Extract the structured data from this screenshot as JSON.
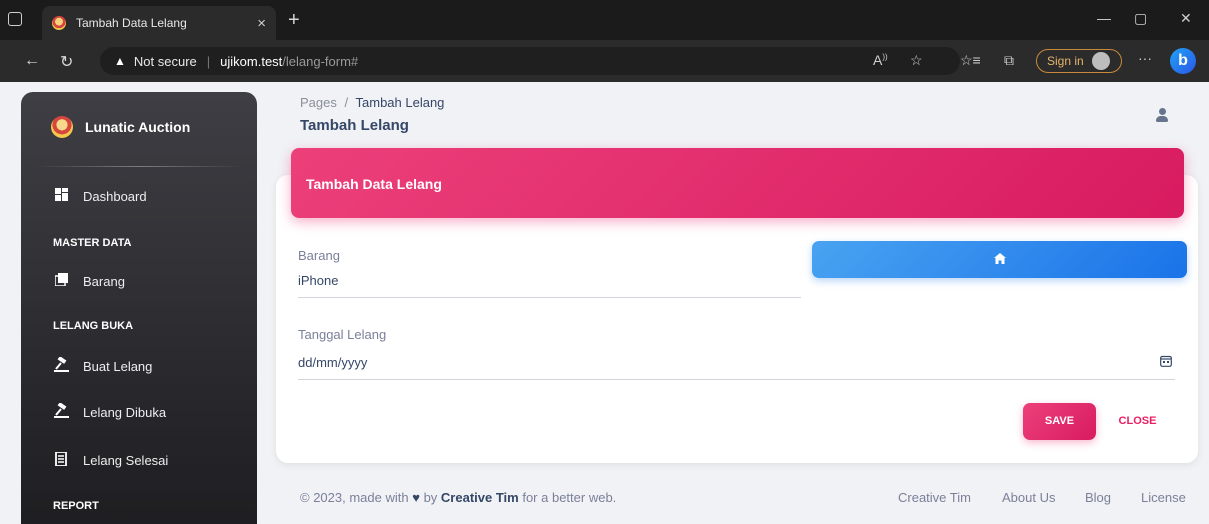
{
  "browser": {
    "tab_title": "Tambah Data Lelang",
    "tab_close": "×",
    "new_tab": "+",
    "minimize": "—",
    "maximize": "▢",
    "close": "✕",
    "security_label": "Not secure",
    "url_host": "ujikom.test",
    "url_path": "/lelang-form#",
    "sign_in": "Sign in",
    "more": "···",
    "bing": "b"
  },
  "sidebar": {
    "brand": "Lunatic Auction",
    "dashboard": "Dashboard",
    "section_master": "MASTER DATA",
    "barang": "Barang",
    "section_lelang": "LELANG BUKA",
    "buat_lelang": "Buat Lelang",
    "lelang_dibuka": "Lelang Dibuka",
    "lelang_selesai": "Lelang Selesai",
    "section_report": "REPORT"
  },
  "header": {
    "breadcrumb_root": "Pages",
    "breadcrumb_sep": "/",
    "breadcrumb_current": "Tambah Lelang",
    "page_title": "Tambah Lelang"
  },
  "form": {
    "card_title": "Tambah Data Lelang",
    "barang_label": "Barang",
    "barang_value": "iPhone",
    "tanggal_label": "Tanggal Lelang",
    "tanggal_value": "dd/mm/yyyy",
    "save": "SAVE",
    "close": "CLOSE"
  },
  "footer": {
    "copyright": "© 2023, made with",
    "by": "by",
    "author": "Creative Tim",
    "suffix": "for a better web.",
    "links": [
      "Creative Tim",
      "About Us",
      "Blog",
      "License"
    ]
  },
  "colors": {
    "primary": "#e91e63",
    "info": "#1a73e8",
    "sidebar": "#2a2a2e"
  }
}
